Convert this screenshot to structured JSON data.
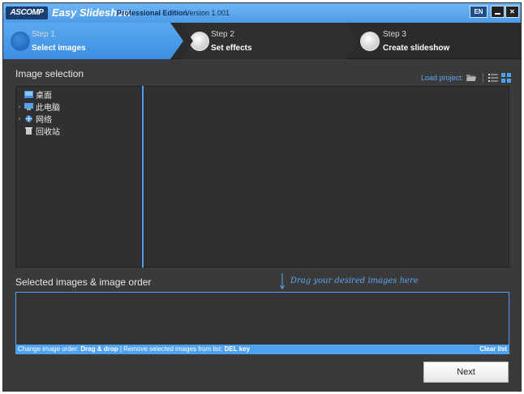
{
  "titlebar": {
    "logo": "ASCOMP",
    "app_name": "Easy Slideshow",
    "edition": "Professional Edition",
    "version": "Version 1.001",
    "language_button": "EN",
    "close_glyph": "✕"
  },
  "steps": [
    {
      "label": "Step 1",
      "title": "Select images",
      "active": true
    },
    {
      "label": "Step 2",
      "title": "Set effects",
      "active": false
    },
    {
      "label": "Step 3",
      "title": "Create slideshow",
      "active": false
    }
  ],
  "image_selection": {
    "title": "Image selection",
    "load_project": "Load project:",
    "tree": [
      {
        "label": "桌面",
        "icon": "desktop-folder-icon",
        "expandable": false
      },
      {
        "label": "此电脑",
        "icon": "computer-icon",
        "expandable": true
      },
      {
        "label": "网络",
        "icon": "network-icon",
        "expandable": true
      },
      {
        "label": "回收站",
        "icon": "recycle-bin-icon",
        "expandable": false
      }
    ]
  },
  "selected_images": {
    "title": "Selected images & image order",
    "drag_hint": "Drag your desired images here",
    "info_prefix": "Change image order: ",
    "info_drag": "Drag & drop",
    "info_mid": " | Remove selected images from list: ",
    "info_key": "DEL key",
    "clear_list": "Clear list"
  },
  "footer": {
    "next_label": "Next"
  },
  "colors": {
    "accent": "#4ea2f0",
    "titlebar": "#5aa9f0",
    "background": "#3a3a3a",
    "panel": "#303030"
  }
}
